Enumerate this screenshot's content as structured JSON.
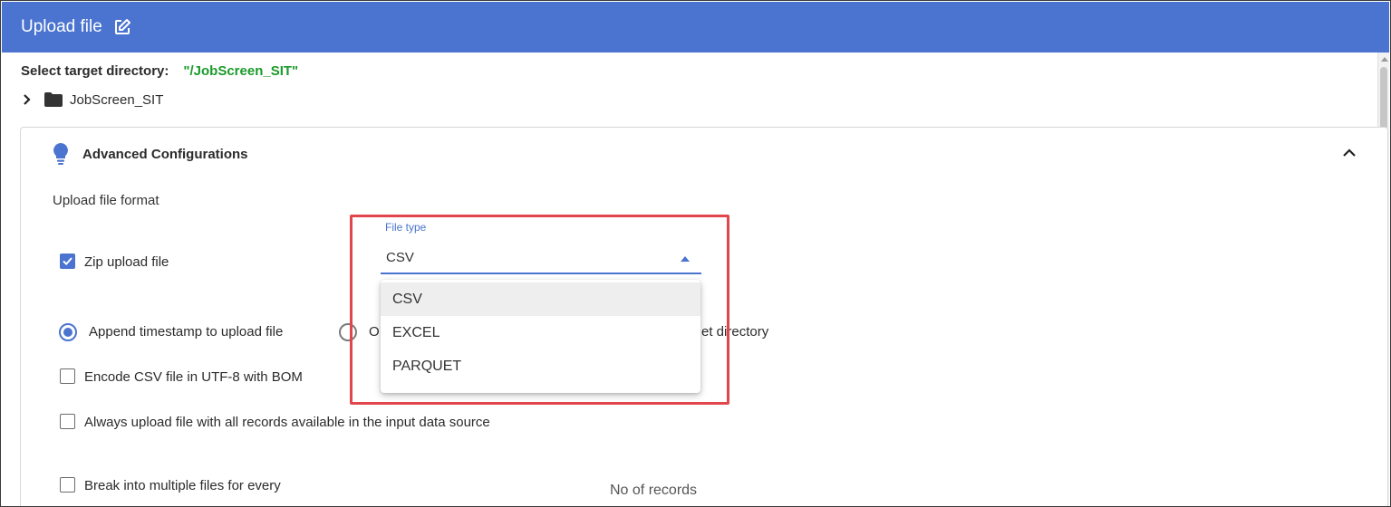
{
  "header": {
    "title": "Upload file",
    "edit_icon": "edit-icon"
  },
  "target": {
    "label": "Select target directory:",
    "path": "\"/JobScreen_SIT\""
  },
  "tree": {
    "folder_label": "JobScreen_SIT"
  },
  "advanced": {
    "title": "Advanced Configurations",
    "format_label": "Upload file format"
  },
  "options": {
    "zip_label": "Zip upload file",
    "zip_checked": true,
    "append_timestamp_label": "Append timestamp to upload file",
    "overwrite_partial_left": "O",
    "overwrite_partial_right": "et directory",
    "encode_bom_label": "Encode CSV file in UTF-8 with BOM",
    "always_upload_label": "Always upload file with all records available in the input data source",
    "break_files_label": "Break into multiple files for every",
    "no_records_label": "No of records"
  },
  "file_type": {
    "label": "File type",
    "value": "CSV",
    "options": [
      "CSV",
      "EXCEL",
      "PARQUET"
    ]
  },
  "colors": {
    "accent": "#4a74cf",
    "path": "#1a9a2a",
    "highlight": "#e0464b"
  }
}
